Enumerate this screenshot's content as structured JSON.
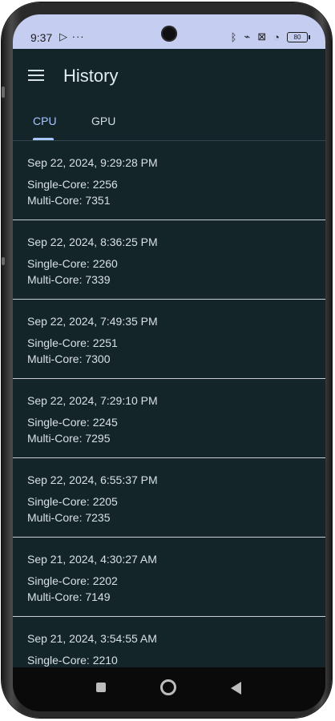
{
  "status_bar": {
    "time": "9:37",
    "extra": "▷ ···",
    "icons": [
      "bluetooth-icon",
      "vibrate-off-icon",
      "no-sim-icon",
      "wifi-icon",
      "battery-icon"
    ],
    "bluetooth_glyph": "ᛒ",
    "vibrate_glyph": "⌁",
    "sim_glyph": "⊠",
    "wifi_glyph": "◔",
    "battery_level": "80"
  },
  "app_bar": {
    "title": "History",
    "menu_icon": "hamburger-menu-icon"
  },
  "tabs": [
    {
      "label": "CPU",
      "active": true
    },
    {
      "label": "GPU",
      "active": false
    }
  ],
  "history": [
    {
      "timestamp": "Sep 22, 2024, 9:29:28 PM",
      "single": "Single-Core: 2256",
      "multi": "Multi-Core: 7351"
    },
    {
      "timestamp": "Sep 22, 2024, 8:36:25 PM",
      "single": "Single-Core: 2260",
      "multi": "Multi-Core: 7339"
    },
    {
      "timestamp": "Sep 22, 2024, 7:49:35 PM",
      "single": "Single-Core: 2251",
      "multi": "Multi-Core: 7300"
    },
    {
      "timestamp": "Sep 22, 2024, 7:29:10 PM",
      "single": "Single-Core: 2245",
      "multi": "Multi-Core: 7295"
    },
    {
      "timestamp": "Sep 22, 2024, 6:55:37 PM",
      "single": "Single-Core: 2205",
      "multi": "Multi-Core: 7235"
    },
    {
      "timestamp": "Sep 21, 2024, 4:30:27 AM",
      "single": "Single-Core: 2202",
      "multi": "Multi-Core: 7149"
    },
    {
      "timestamp": "Sep 21, 2024, 3:54:55 AM",
      "single": "Single-Core: 2210",
      "multi": ""
    }
  ],
  "colors": {
    "background": "#14252a",
    "status_bar": "#c5cdf0",
    "accent": "#a9c7ff",
    "divider": "#c8d0d3"
  }
}
